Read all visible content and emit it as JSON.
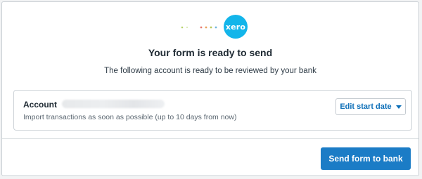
{
  "logo": {
    "text": "xero",
    "icon": "xero-logo-icon",
    "brand_color": "#13b5ea"
  },
  "header": {
    "title": "Your form is ready to send",
    "subtitle": "The following account is ready to be reviewed by your bank"
  },
  "account": {
    "label": "Account",
    "description": "Import transactions as soon as possible (up to 10 days from now)",
    "edit_button_label": "Edit start date",
    "edit_button_icon": "chevron-down-icon"
  },
  "footer": {
    "send_button_label": "Send form to bank"
  },
  "colors": {
    "accent": "#0d6fb8",
    "primary_button": "#1b7cc6"
  }
}
